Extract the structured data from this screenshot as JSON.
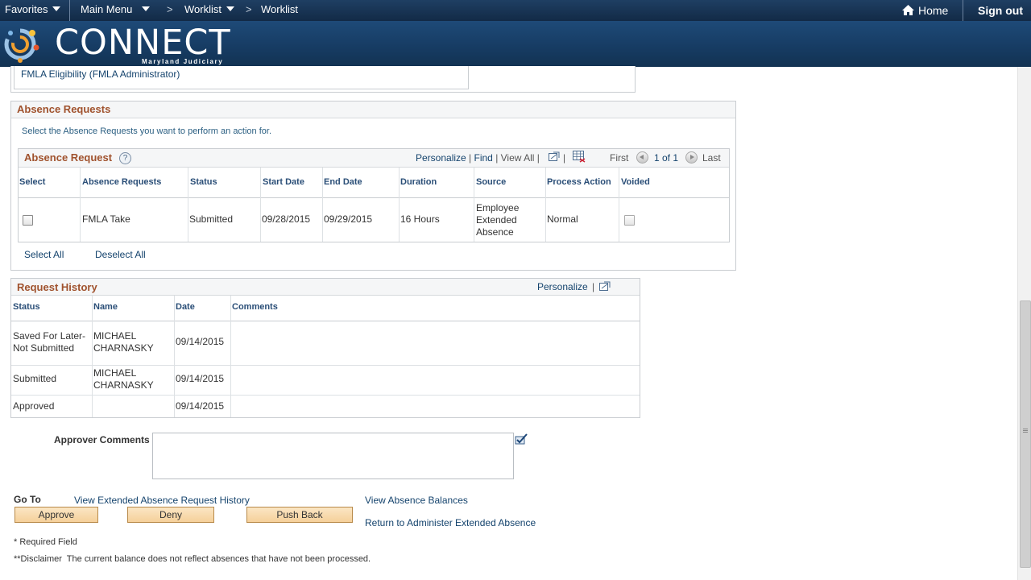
{
  "topnav": {
    "favorites": "Favorites",
    "main_menu": "Main Menu",
    "worklist_menu": "Worklist",
    "worklist_crumb": "Worklist",
    "home": "Home",
    "sign_out": "Sign out"
  },
  "banner": {
    "logo_word": "CONNECT",
    "logo_sub": "Maryland Judiciary"
  },
  "prev_link": "FMLA Eligibility (FMLA Administrator)",
  "absence_requests": {
    "title": "Absence Requests",
    "instruction": "Select the Absence Requests you want to perform an action for.",
    "grid": {
      "title": "Absence Request",
      "help_icon": "?",
      "personalize": "Personalize",
      "find": "Find",
      "view_all": "View All",
      "first": "First",
      "page_info": "1 of 1",
      "last": "Last",
      "columns": [
        "Select",
        "Absence Requests",
        "Status",
        "Start Date",
        "End Date",
        "Duration",
        "Source",
        "Process Action",
        "Voided"
      ],
      "rows": [
        {
          "request": "FMLA Take",
          "status": "Submitted",
          "start": "09/28/2015",
          "end": "09/29/2015",
          "duration": "16 Hours",
          "source": "Employee Extended Absence",
          "action": "Normal"
        }
      ]
    },
    "select_all": "Select All",
    "deselect_all": "Deselect All"
  },
  "history": {
    "title": "Request History",
    "personalize": "Personalize",
    "columns": [
      "Status",
      "Name",
      "Date",
      "Comments"
    ],
    "rows": [
      {
        "status": "Saved For Later-Not Submitted",
        "name": "MICHAEL CHARNASKY",
        "date": "09/14/2015",
        "comments": ""
      },
      {
        "status": "Submitted",
        "name": "MICHAEL CHARNASKY",
        "date": "09/14/2015",
        "comments": ""
      },
      {
        "status": "Approved",
        "name": "",
        "date": "09/14/2015",
        "comments": ""
      }
    ]
  },
  "approver_comments_label": "Approver Comments",
  "goto_label": "Go To",
  "links": {
    "view_history": "View Extended Absence Request History",
    "view_balances": "View Absence Balances",
    "return": "Return to Administer Extended Absence"
  },
  "buttons": {
    "approve": "Approve",
    "deny": "Deny",
    "push_back": "Push Back"
  },
  "required_note": "* Required Field",
  "disclaimer": "**Disclaimer  The current balance does not reflect absences that have not been processed."
}
